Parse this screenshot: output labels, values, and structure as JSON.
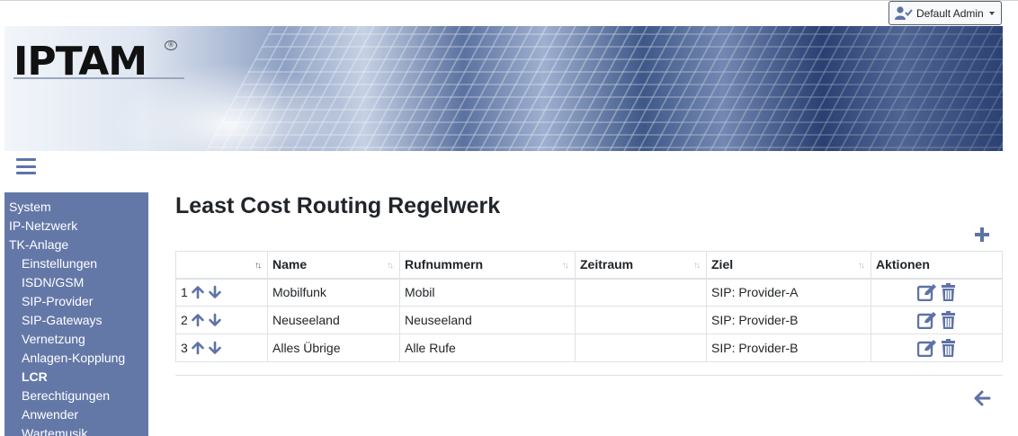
{
  "user_menu": {
    "label": "Default Admin",
    "icon": "user-check-icon"
  },
  "logo": {
    "text": "IPTAM",
    "mark": "®"
  },
  "sidebar": {
    "items": [
      {
        "label": "System",
        "level": 0
      },
      {
        "label": "IP-Netzwerk",
        "level": 0
      },
      {
        "label": "TK-Anlage",
        "level": 0
      },
      {
        "label": "Einstellungen",
        "level": 1
      },
      {
        "label": "ISDN/GSM",
        "level": 1
      },
      {
        "label": "SIP-Provider",
        "level": 1
      },
      {
        "label": "SIP-Gateways",
        "level": 1
      },
      {
        "label": "Vernetzung",
        "level": 1
      },
      {
        "label": "Anlagen-Kopplung",
        "level": 1
      },
      {
        "label": "LCR",
        "level": 1,
        "active": true
      },
      {
        "label": "Berechtigungen",
        "level": 1
      },
      {
        "label": "Anwender",
        "level": 1
      },
      {
        "label": "Wartemusik",
        "level": 1
      }
    ]
  },
  "page": {
    "title": "Least Cost Routing Regelwerk"
  },
  "table": {
    "columns": [
      "",
      "Name",
      "Rufnummern",
      "Zeitraum",
      "Ziel",
      "Aktionen"
    ],
    "rows": [
      {
        "order": "1",
        "name": "Mobilfunk",
        "numbers": "Mobil",
        "period": "",
        "target": "SIP: Provider-A"
      },
      {
        "order": "2",
        "name": "Neuseeland",
        "numbers": "Neuseeland",
        "period": "",
        "target": "SIP: Provider-B"
      },
      {
        "order": "3",
        "name": "Alles Übrige",
        "numbers": "Alle Rufe",
        "period": "",
        "target": "SIP: Provider-B"
      }
    ]
  },
  "colors": {
    "accent": "#5e72a6",
    "sidebar_bg": "#6478a8"
  },
  "icons": {
    "add": "plus-icon",
    "back": "arrow-left-icon",
    "up": "arrow-up-icon",
    "down": "arrow-down-icon",
    "edit": "edit-icon",
    "delete": "trash-icon"
  }
}
